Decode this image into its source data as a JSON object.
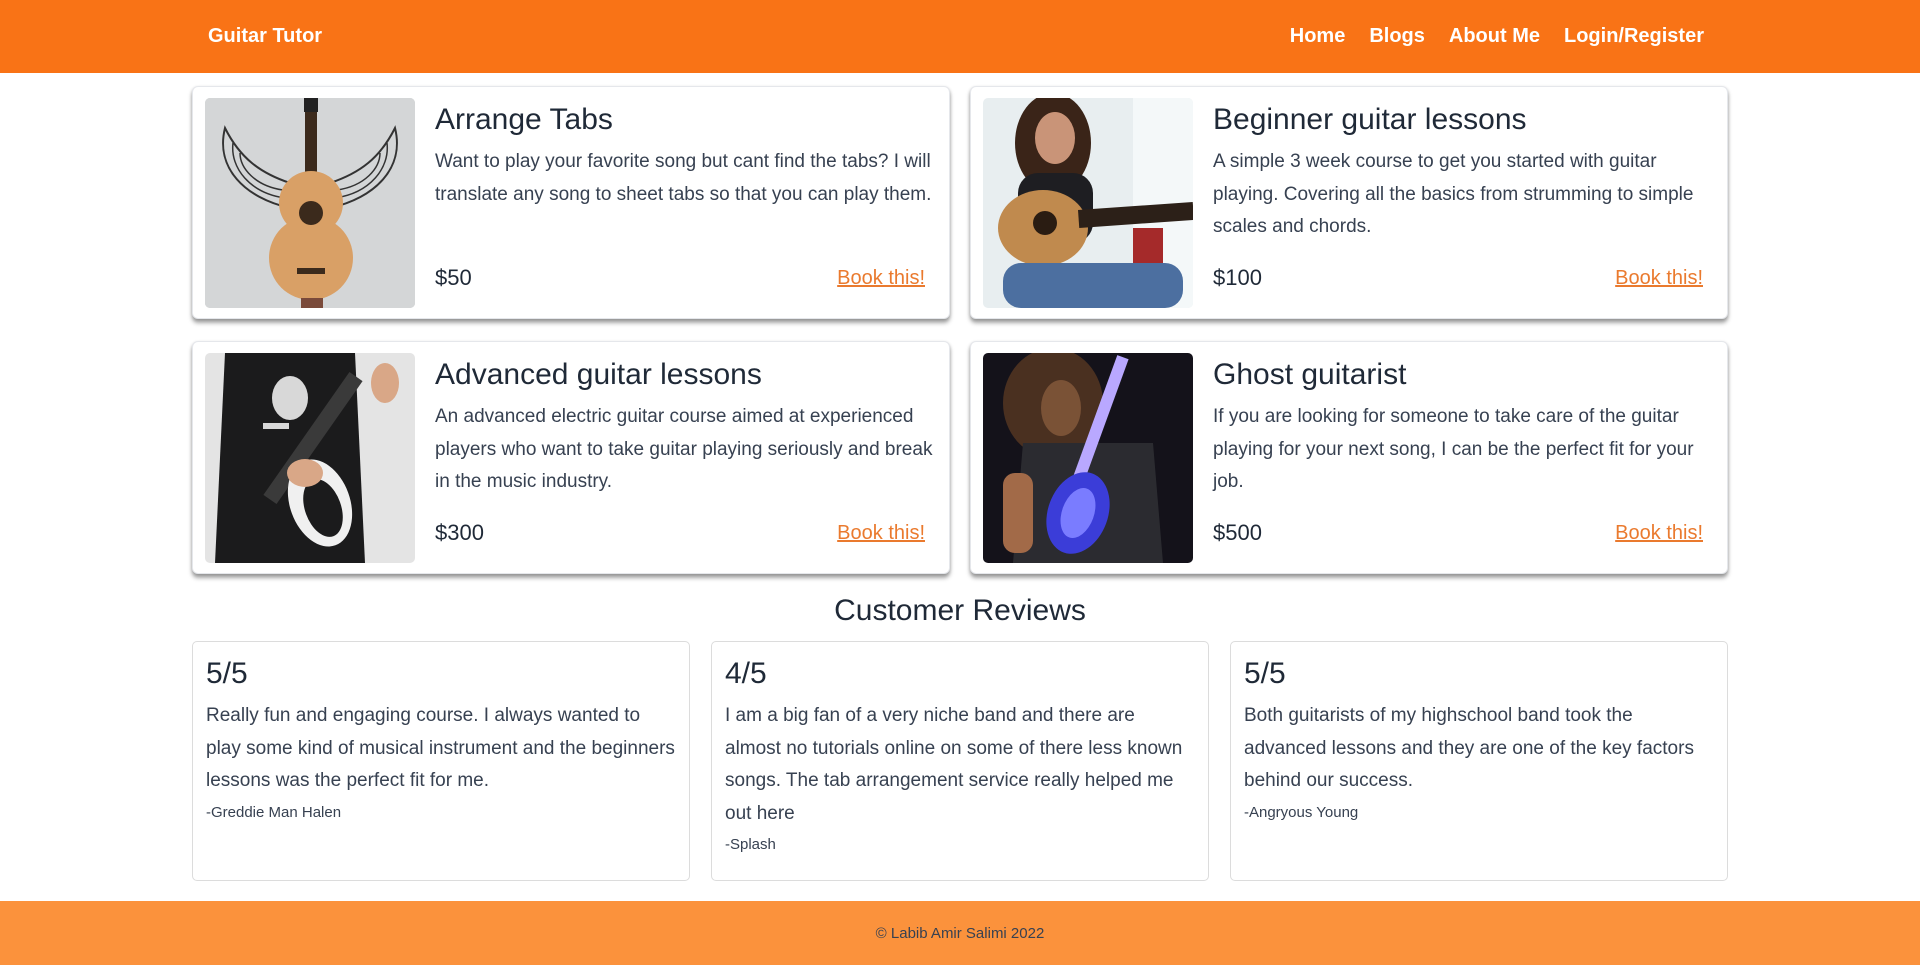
{
  "nav": {
    "brand": "Guitar Tutor",
    "links": [
      "Home",
      "Blogs",
      "About Me",
      "Login/Register"
    ]
  },
  "services": [
    {
      "image": "guitar-with-wings-photo",
      "title": "Arrange Tabs",
      "description": "Want to play your favorite song but cant find the tabs? I will translate any song to sheet tabs so that you can play them.",
      "price": "$50",
      "cta": "Book this!"
    },
    {
      "image": "woman-playing-acoustic-guitar-photo",
      "title": "Beginner guitar lessons",
      "description": "A simple 3 week course to get you started with guitar playing. Covering all the basics from strumming to simple scales and chords.",
      "price": "$100",
      "cta": "Book this!"
    },
    {
      "image": "person-playing-electric-guitar-photo",
      "title": "Advanced guitar lessons",
      "description": "An advanced electric guitar course aimed at experienced players who want to take guitar playing seriously and break in the music industry.",
      "price": "$300",
      "cta": "Book this!"
    },
    {
      "image": "guitarist-on-stage-photo",
      "title": "Ghost guitarist",
      "description": "If you are looking for someone to take care of the guitar playing for your next song, I can be the perfect fit for your job.",
      "price": "$500",
      "cta": "Book this!"
    }
  ],
  "reviews": {
    "heading": "Customer Reviews",
    "items": [
      {
        "rating": "5/5",
        "text": "Really fun and engaging course. I always wanted to play some kind of musical instrument and the beginners lessons was the perfect fit for me.",
        "author": "-Greddie Man Halen"
      },
      {
        "rating": "4/5",
        "text": "I am a big fan of a very niche band and there are almost no tutorials online on some of there less known songs. The tab arrangement service really helped me out here",
        "author": "-Splash"
      },
      {
        "rating": "5/5",
        "text": "Both guitarists of my highschool band took the advanced lessons and they are one of the key factors behind our success.",
        "author": "-Angryous Young"
      }
    ]
  },
  "footer": {
    "text": "© Labib Amir Salimi 2022"
  },
  "colors": {
    "navbar": "#f97316",
    "footer": "#fb923c",
    "accent_link": "#ea7a2e"
  }
}
